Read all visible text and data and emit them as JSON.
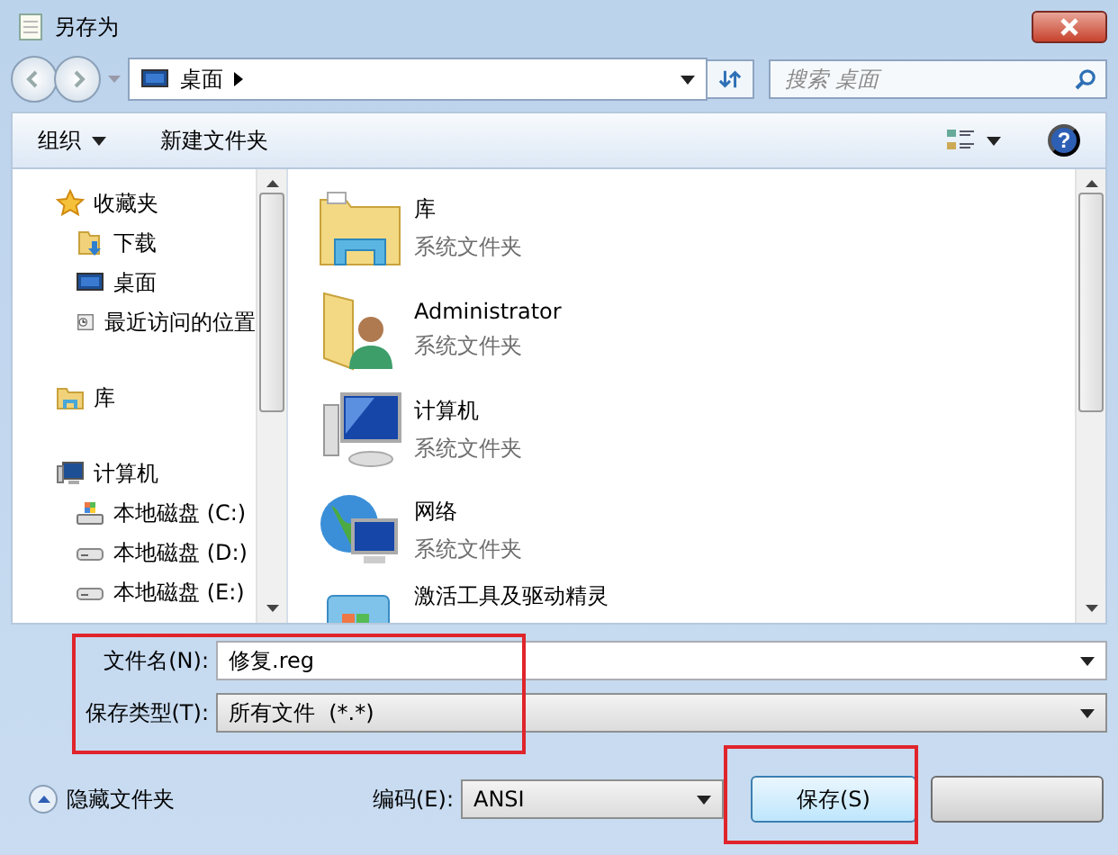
{
  "window": {
    "title": "另存为"
  },
  "address": {
    "location": "桌面"
  },
  "search": {
    "placeholder": "搜索 桌面"
  },
  "toolbar": {
    "organize": "组织",
    "new_folder": "新建文件夹",
    "help": "?"
  },
  "sidebar": {
    "items": [
      {
        "label": "收藏夹",
        "kind": "star",
        "children": [
          {
            "label": "下载",
            "kind": "download"
          },
          {
            "label": "桌面",
            "kind": "desktop"
          },
          {
            "label": "最近访问的位置",
            "kind": "recent"
          }
        ]
      },
      {
        "label": "库",
        "kind": "library"
      },
      {
        "label": "计算机",
        "kind": "computer",
        "children": [
          {
            "label": "本地磁盘 (C:)",
            "kind": "system-drive"
          },
          {
            "label": "本地磁盘 (D:)",
            "kind": "drive"
          },
          {
            "label": "本地磁盘 (E:)",
            "kind": "drive"
          }
        ]
      }
    ]
  },
  "files": [
    {
      "name": "库",
      "type": "系统文件夹",
      "kind": "library"
    },
    {
      "name": "Administrator",
      "type": "系统文件夹",
      "kind": "user"
    },
    {
      "name": "计算机",
      "type": "系统文件夹",
      "kind": "computer"
    },
    {
      "name": "网络",
      "type": "系统文件夹",
      "kind": "network"
    },
    {
      "name": "激活工具及驱动精灵",
      "kind": "app"
    }
  ],
  "form": {
    "file_name_label": "文件名(N):",
    "file_name": "修复.reg",
    "type_label": "保存类型(T):",
    "type": "所有文件  (*.*)"
  },
  "footer": {
    "hide_folders": "隐藏文件夹",
    "encoding_label": "编码(E):",
    "encoding": "ANSI",
    "save": "保存(S)"
  },
  "highlights": {
    "form": true,
    "save": true
  }
}
